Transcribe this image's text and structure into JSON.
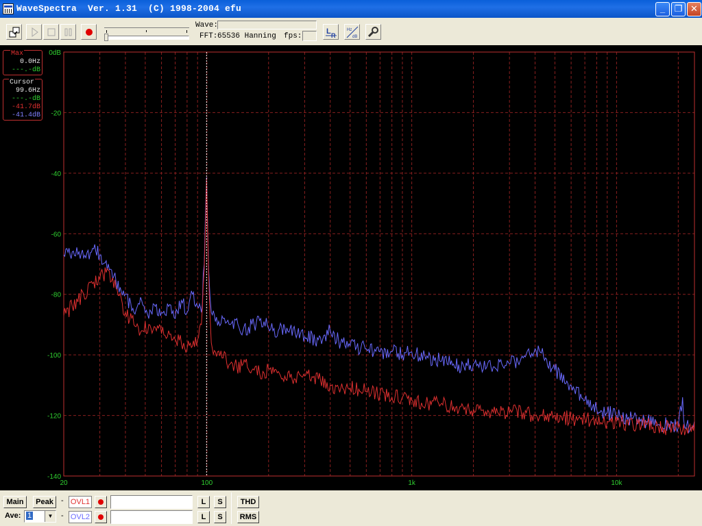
{
  "window": {
    "title": "WaveSpectra  Ver. 1.31  (C) 1998-2004 efu",
    "minimize": "_",
    "maximize": "❐",
    "close": "✕"
  },
  "toolbar": {
    "wave_label": "Wave:",
    "fft_label": "FFT:",
    "fft_value": "65536 Hanning",
    "fps_label": "fps:",
    "icons": [
      "transfer-icon",
      "play-icon",
      "stop-icon",
      "pause-icon",
      "record-icon",
      "lr-channel-icon",
      "hz-db-axis-icon",
      "settings-wrench-icon"
    ]
  },
  "readouts": {
    "max": {
      "title": "Max",
      "freq": "0.0Hz",
      "level": "---.-dB"
    },
    "cursor": {
      "title": "Cursor",
      "freq": "99.6Hz",
      "level_green": "---.-dB",
      "level_red": "-41.7dB",
      "level_blue": "-41.4dB"
    }
  },
  "chart_data": {
    "type": "line",
    "x_scale": "log",
    "xlim": [
      20,
      24000
    ],
    "ylim": [
      -140,
      0
    ],
    "x_ticks": [
      {
        "value": 20,
        "label": "20"
      },
      {
        "value": 100,
        "label": "100"
      },
      {
        "value": 1000,
        "label": "1k"
      },
      {
        "value": 10000,
        "label": "10k"
      }
    ],
    "y_ticks": [
      {
        "value": 0,
        "label": "0dB"
      },
      {
        "value": -20,
        "label": "-20"
      },
      {
        "value": -40,
        "label": "-40"
      },
      {
        "value": -60,
        "label": "-60"
      },
      {
        "value": -80,
        "label": "-80"
      },
      {
        "value": -100,
        "label": "-100"
      },
      {
        "value": -120,
        "label": "-120"
      },
      {
        "value": -140,
        "label": "-140"
      }
    ],
    "cursor_x": 99.6,
    "grid": true,
    "colors": {
      "background": "#000000",
      "grid": "#8a1f1f",
      "frame": "#c03030",
      "axis_text": "#30d030",
      "cursor": "#ffffff"
    },
    "series": [
      {
        "color": "#6a6aff",
        "x": [
          20,
          22,
          25,
          28,
          30,
          33,
          36,
          40,
          44,
          48,
          52,
          56,
          60,
          65,
          70,
          75,
          80,
          85,
          90,
          94,
          97,
          99.6,
          102,
          105,
          110,
          120,
          130,
          140,
          150,
          170,
          190,
          210,
          240,
          270,
          300,
          350,
          400,
          450,
          500,
          600,
          700,
          800,
          900,
          1000,
          1200,
          1400,
          1600,
          1800,
          2000,
          2500,
          3000,
          3500,
          4000,
          4500,
          5000,
          6000,
          7000,
          8000,
          9000,
          10000,
          12000,
          14000,
          16000,
          18000,
          20000,
          21000,
          21500,
          22000,
          23000,
          24000
        ],
        "y": [
          -67,
          -66,
          -68,
          -65,
          -67,
          -70,
          -76,
          -80,
          -86,
          -82,
          -88,
          -84,
          -86,
          -84,
          -88,
          -82,
          -86,
          -80,
          -84,
          -86,
          -70,
          -41.4,
          -72,
          -86,
          -89,
          -88,
          -90,
          -88,
          -92,
          -90,
          -89,
          -92,
          -91,
          -93,
          -94,
          -95,
          -92,
          -96,
          -97,
          -98,
          -99,
          -99,
          -100,
          -99,
          -101,
          -102,
          -103,
          -104,
          -103,
          -104,
          -103,
          -101,
          -98,
          -101,
          -105,
          -110,
          -115,
          -118,
          -119,
          -120,
          -121,
          -122,
          -123,
          -123,
          -124,
          -114,
          -124,
          -123,
          -124,
          -122
        ]
      },
      {
        "color": "#e03030",
        "x": [
          20,
          22,
          25,
          28,
          30,
          33,
          36,
          40,
          44,
          48,
          52,
          56,
          60,
          65,
          70,
          75,
          80,
          85,
          90,
          94,
          97,
          99.6,
          102,
          105,
          110,
          120,
          130,
          140,
          150,
          170,
          190,
          210,
          240,
          270,
          300,
          350,
          400,
          450,
          500,
          600,
          700,
          800,
          900,
          1000,
          1200,
          1400,
          1600,
          1800,
          2000,
          2500,
          3000,
          3500,
          4000,
          4500,
          5000,
          6000,
          7000,
          8000,
          9000,
          10000,
          12000,
          14000,
          16000,
          18000,
          20000,
          22000,
          25000,
          28000,
          30000,
          33000,
          36000,
          40000
        ],
        "y": [
          -87,
          -84,
          -80,
          -76,
          -75,
          -72,
          -78,
          -86,
          -90,
          -92,
          -90,
          -91,
          -93,
          -92,
          -95,
          -96,
          -98,
          -97,
          -95,
          -90,
          -72,
          -41.7,
          -74,
          -96,
          -99,
          -101,
          -103,
          -104,
          -103,
          -105,
          -106,
          -104,
          -107,
          -108,
          -107,
          -108,
          -110,
          -111,
          -111,
          -112,
          -113,
          -114,
          -114,
          -115,
          -116,
          -116,
          -117,
          -118,
          -118,
          -119,
          -119,
          -119,
          -120,
          -120,
          -120,
          -121,
          -121,
          -122,
          -122,
          -122,
          -123,
          -123,
          -124,
          -124,
          -124,
          -124,
          -124,
          -123,
          -123,
          -123,
          -123,
          -122
        ]
      }
    ]
  },
  "bottom": {
    "main_label": "Main",
    "peak_label": "Peak",
    "dash": "-",
    "ovl1_label": "OVL1",
    "ovl2_label": "OVL2",
    "l_label": "L",
    "s_label": "S",
    "thd_label": "THD",
    "rms_label": "RMS",
    "ave_label": "Ave:",
    "ave_value": "1"
  }
}
